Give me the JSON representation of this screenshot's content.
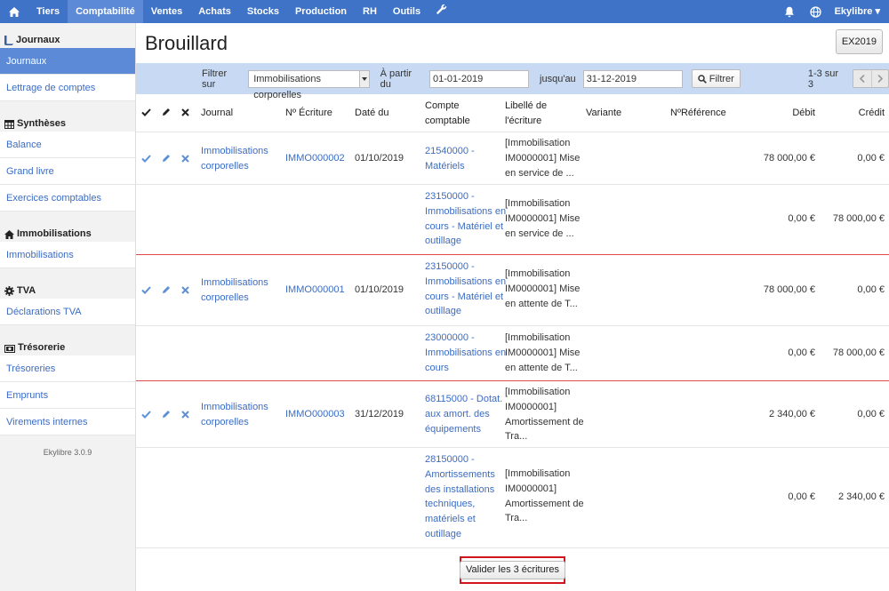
{
  "topnav": {
    "items": [
      "Tiers",
      "Comptabilité",
      "Ventes",
      "Achats",
      "Stocks",
      "Production",
      "RH",
      "Outils"
    ],
    "active": "Comptabilité",
    "user": "Ekylibre"
  },
  "sidebar": {
    "sections": [
      {
        "title": "Journaux",
        "icon": "book-icon",
        "items": [
          "Journaux",
          "Lettrage de comptes"
        ]
      },
      {
        "title": "Synthèses",
        "icon": "table-icon",
        "items": [
          "Balance",
          "Grand livre",
          "Exercices comptables"
        ]
      },
      {
        "title": "Immobilisations",
        "icon": "house-icon",
        "items": [
          "Immobilisations"
        ]
      },
      {
        "title": "TVA",
        "icon": "gear-icon",
        "items": [
          "Déclarations TVA"
        ]
      },
      {
        "title": "Trésorerie",
        "icon": "money-icon",
        "items": [
          "Trésoreries",
          "Emprunts",
          "Virements internes"
        ]
      }
    ],
    "version": "Ekylibre 3.0.9"
  },
  "page": {
    "title": "Brouillard",
    "fiscal_year_button": "EX2019"
  },
  "filter": {
    "label_filter_on": "Filtrer sur",
    "journal_select": "Immobilisations corporelles",
    "label_from": "À partir du",
    "from_date": "01-01-2019",
    "label_to": "jusqu'au",
    "to_date": "31-12-2019",
    "filter_button": "Filtrer",
    "pagination": "1-3 sur 3"
  },
  "table": {
    "headers": {
      "journal": "Journal",
      "number": "Nº Écriture",
      "date": "Daté du",
      "account": [
        "Compte",
        "comptable"
      ],
      "label": [
        "Libellé de",
        "l'écriture"
      ],
      "variant": "Variante",
      "reference": "NºRéférence",
      "debit": "Débit",
      "credit": "Crédit"
    },
    "entries": [
      {
        "journal": [
          "Immobilisations",
          "corporelles"
        ],
        "number": "IMMO000002",
        "date": "01/10/2019",
        "lines": [
          {
            "account": [
              "21540000 -",
              "Matériels"
            ],
            "label": [
              "[Immobilisation",
              "IM0000001] Mise",
              "en service de ..."
            ],
            "debit": "78 000,00 €",
            "credit": "0,00 €"
          },
          {
            "account": [
              "23150000 -",
              "Immobilisations en",
              "cours - Matériel et",
              "outillage"
            ],
            "label": [
              "[Immobilisation",
              "IM0000001] Mise",
              "en service de ..."
            ],
            "debit": "0,00 €",
            "credit": "78 000,00 €"
          }
        ]
      },
      {
        "journal": [
          "Immobilisations",
          "corporelles"
        ],
        "number": "IMMO000001",
        "date": "01/10/2019",
        "lines": [
          {
            "account": [
              "23150000 -",
              "Immobilisations en",
              "cours - Matériel et",
              "outillage"
            ],
            "label": [
              "[Immobilisation",
              "IM0000001] Mise",
              "en attente de T..."
            ],
            "debit": "78 000,00 €",
            "credit": "0,00 €"
          },
          {
            "account": [
              "23000000 -",
              "Immobilisations en",
              "cours"
            ],
            "label": [
              "[Immobilisation",
              "IM0000001] Mise",
              "en attente de T..."
            ],
            "debit": "0,00 €",
            "credit": "78 000,00 €"
          }
        ]
      },
      {
        "journal": [
          "Immobilisations",
          "corporelles"
        ],
        "number": "IMMO000003",
        "date": "31/12/2019",
        "lines": [
          {
            "account": [
              "68115000 - Dotat.",
              "aux amort. des",
              "équipements"
            ],
            "label": [
              "[Immobilisation",
              "IM0000001]",
              "Amortissement de",
              "Tra..."
            ],
            "debit": "2 340,00 €",
            "credit": "0,00 €"
          },
          {
            "account": [
              "28150000 -",
              "Amortissements",
              "des installations",
              "techniques,",
              "matériels et",
              "outillage"
            ],
            "label": [
              "[Immobilisation",
              "IM0000001]",
              "Amortissement de",
              "Tra..."
            ],
            "debit": "0,00 €",
            "credit": "2 340,00 €"
          }
        ]
      }
    ]
  },
  "footer": {
    "validate_button": "Valider les 3 écritures"
  },
  "colors": {
    "navbar": "#3e73c8",
    "active": "#5c8ad6",
    "filterbar": "#c7d9f3",
    "link": "#3b6cc4",
    "entry_separator": "#e04a4a",
    "highlight": "#d0161c"
  }
}
